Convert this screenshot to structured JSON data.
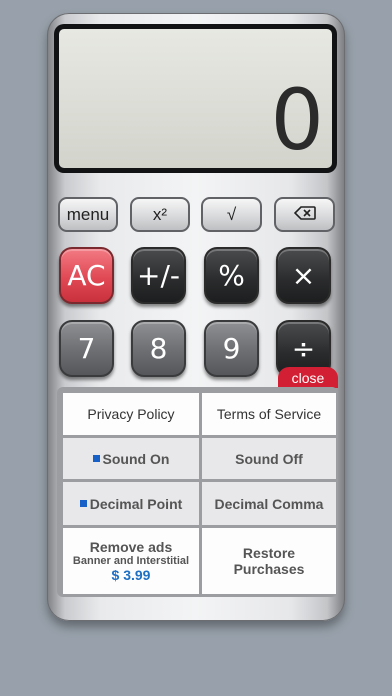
{
  "display": {
    "value": "0"
  },
  "function_row": {
    "menu": "menu",
    "square": "x²",
    "sqrt": "√",
    "backspace_icon": "backspace-icon"
  },
  "keys": {
    "ac": "AC",
    "plus_minus": "+/-",
    "percent": "%",
    "multiply": "×",
    "seven": "7",
    "eight": "8",
    "nine": "9",
    "divide": "÷"
  },
  "menu": {
    "close": "close",
    "privacy": "Privacy Policy",
    "terms": "Terms of Service",
    "sound_on": "Sound On",
    "sound_off": "Sound Off",
    "decimal_point": "Decimal Point",
    "decimal_comma": "Decimal Comma",
    "remove_ads": "Remove ads",
    "remove_ads_sub": "Banner and Interstitial",
    "price": "$ 3.99",
    "restore_line1": "Restore",
    "restore_line2": "Purchases"
  },
  "colors": {
    "accent": "#d21f33",
    "selected": "#1760c8",
    "price": "#1f6fc3"
  }
}
